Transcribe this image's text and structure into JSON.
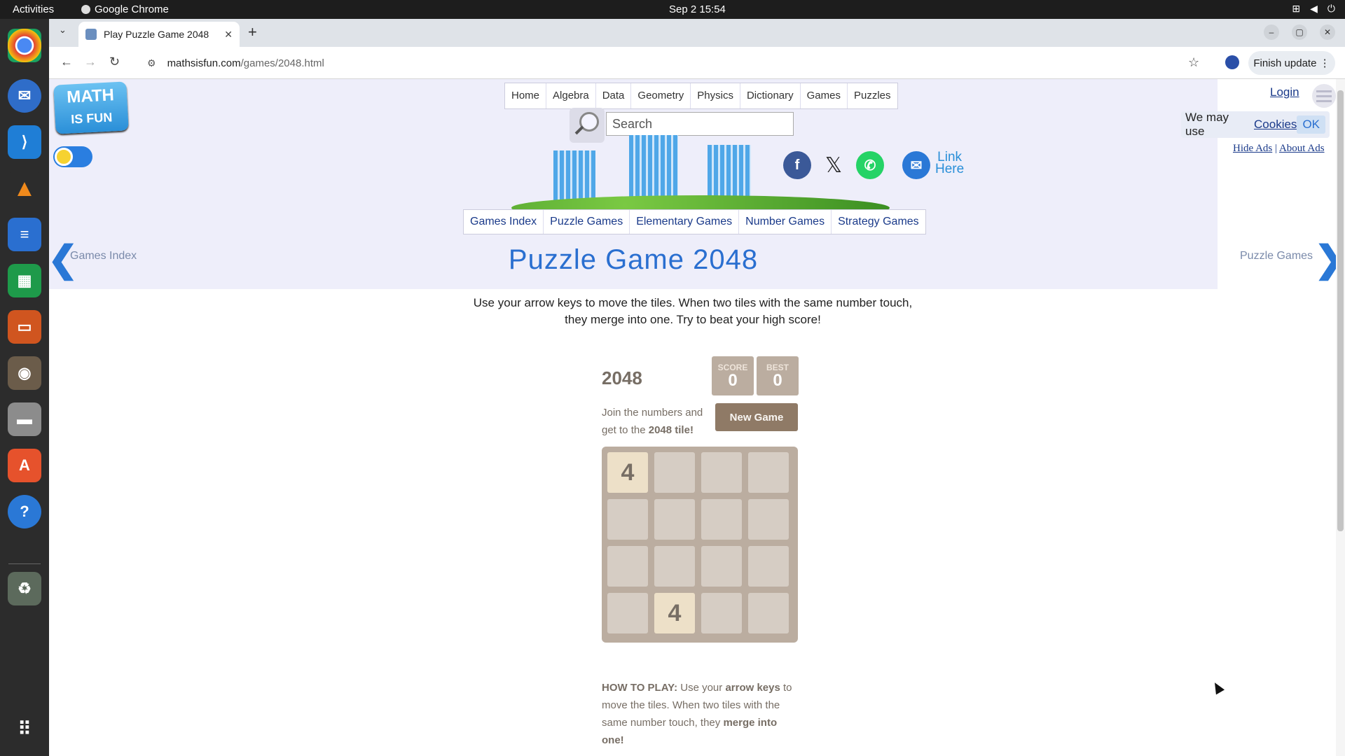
{
  "system": {
    "activities": "Activities",
    "app_name": "Google Chrome",
    "clock": "Sep 2  15:54"
  },
  "browser": {
    "tab_title": "Play Puzzle Game 2048",
    "url_domain": "mathsisfun.com",
    "url_path": "/games/2048.html",
    "finish_update": "Finish update"
  },
  "site": {
    "logo_line1": "MATH",
    "logo_line2": "IS FUN",
    "top_nav": [
      "Home",
      "Algebra",
      "Data",
      "Geometry",
      "Physics",
      "Dictionary",
      "Games",
      "Puzzles"
    ],
    "search_placeholder": "Search",
    "link_here_1": "Link",
    "link_here_2": "Here",
    "sub_nav": [
      "Games Index",
      "Puzzle Games",
      "Elementary Games",
      "Number Games",
      "Strategy Games"
    ],
    "page_title": "Puzzle Game 2048",
    "prev_link": "Games Index",
    "next_link": "Puzzle Games",
    "login": "Login",
    "cookie_text": "We may use",
    "cookie_link": "Cookies",
    "cookie_ok": "OK",
    "hide_ads": "Hide Ads",
    "ad_sep": "|",
    "about_ads": "About Ads",
    "intro_1": "Use your arrow keys to move the tiles. When two tiles with the same number touch,",
    "intro_2": "they merge into one. Try to beat your high score!"
  },
  "game": {
    "title": "2048",
    "score_label": "SCORE",
    "score": "0",
    "best_label": "BEST",
    "best": "0",
    "intro_text": "Join the numbers and get to the",
    "intro_bold": "2048 tile!",
    "new_game": "New Game",
    "board": [
      [
        "4",
        "",
        "",
        ""
      ],
      [
        "",
        "",
        "",
        ""
      ],
      [
        "",
        "",
        "",
        ""
      ],
      [
        "",
        "4",
        "",
        ""
      ]
    ],
    "howto_label": "HOW TO PLAY:",
    "howto_1": "Use your",
    "howto_keys": "arrow keys",
    "howto_2": "to move the tiles. When two tiles with the same number touch, they",
    "howto_merge": "merge into one!"
  }
}
